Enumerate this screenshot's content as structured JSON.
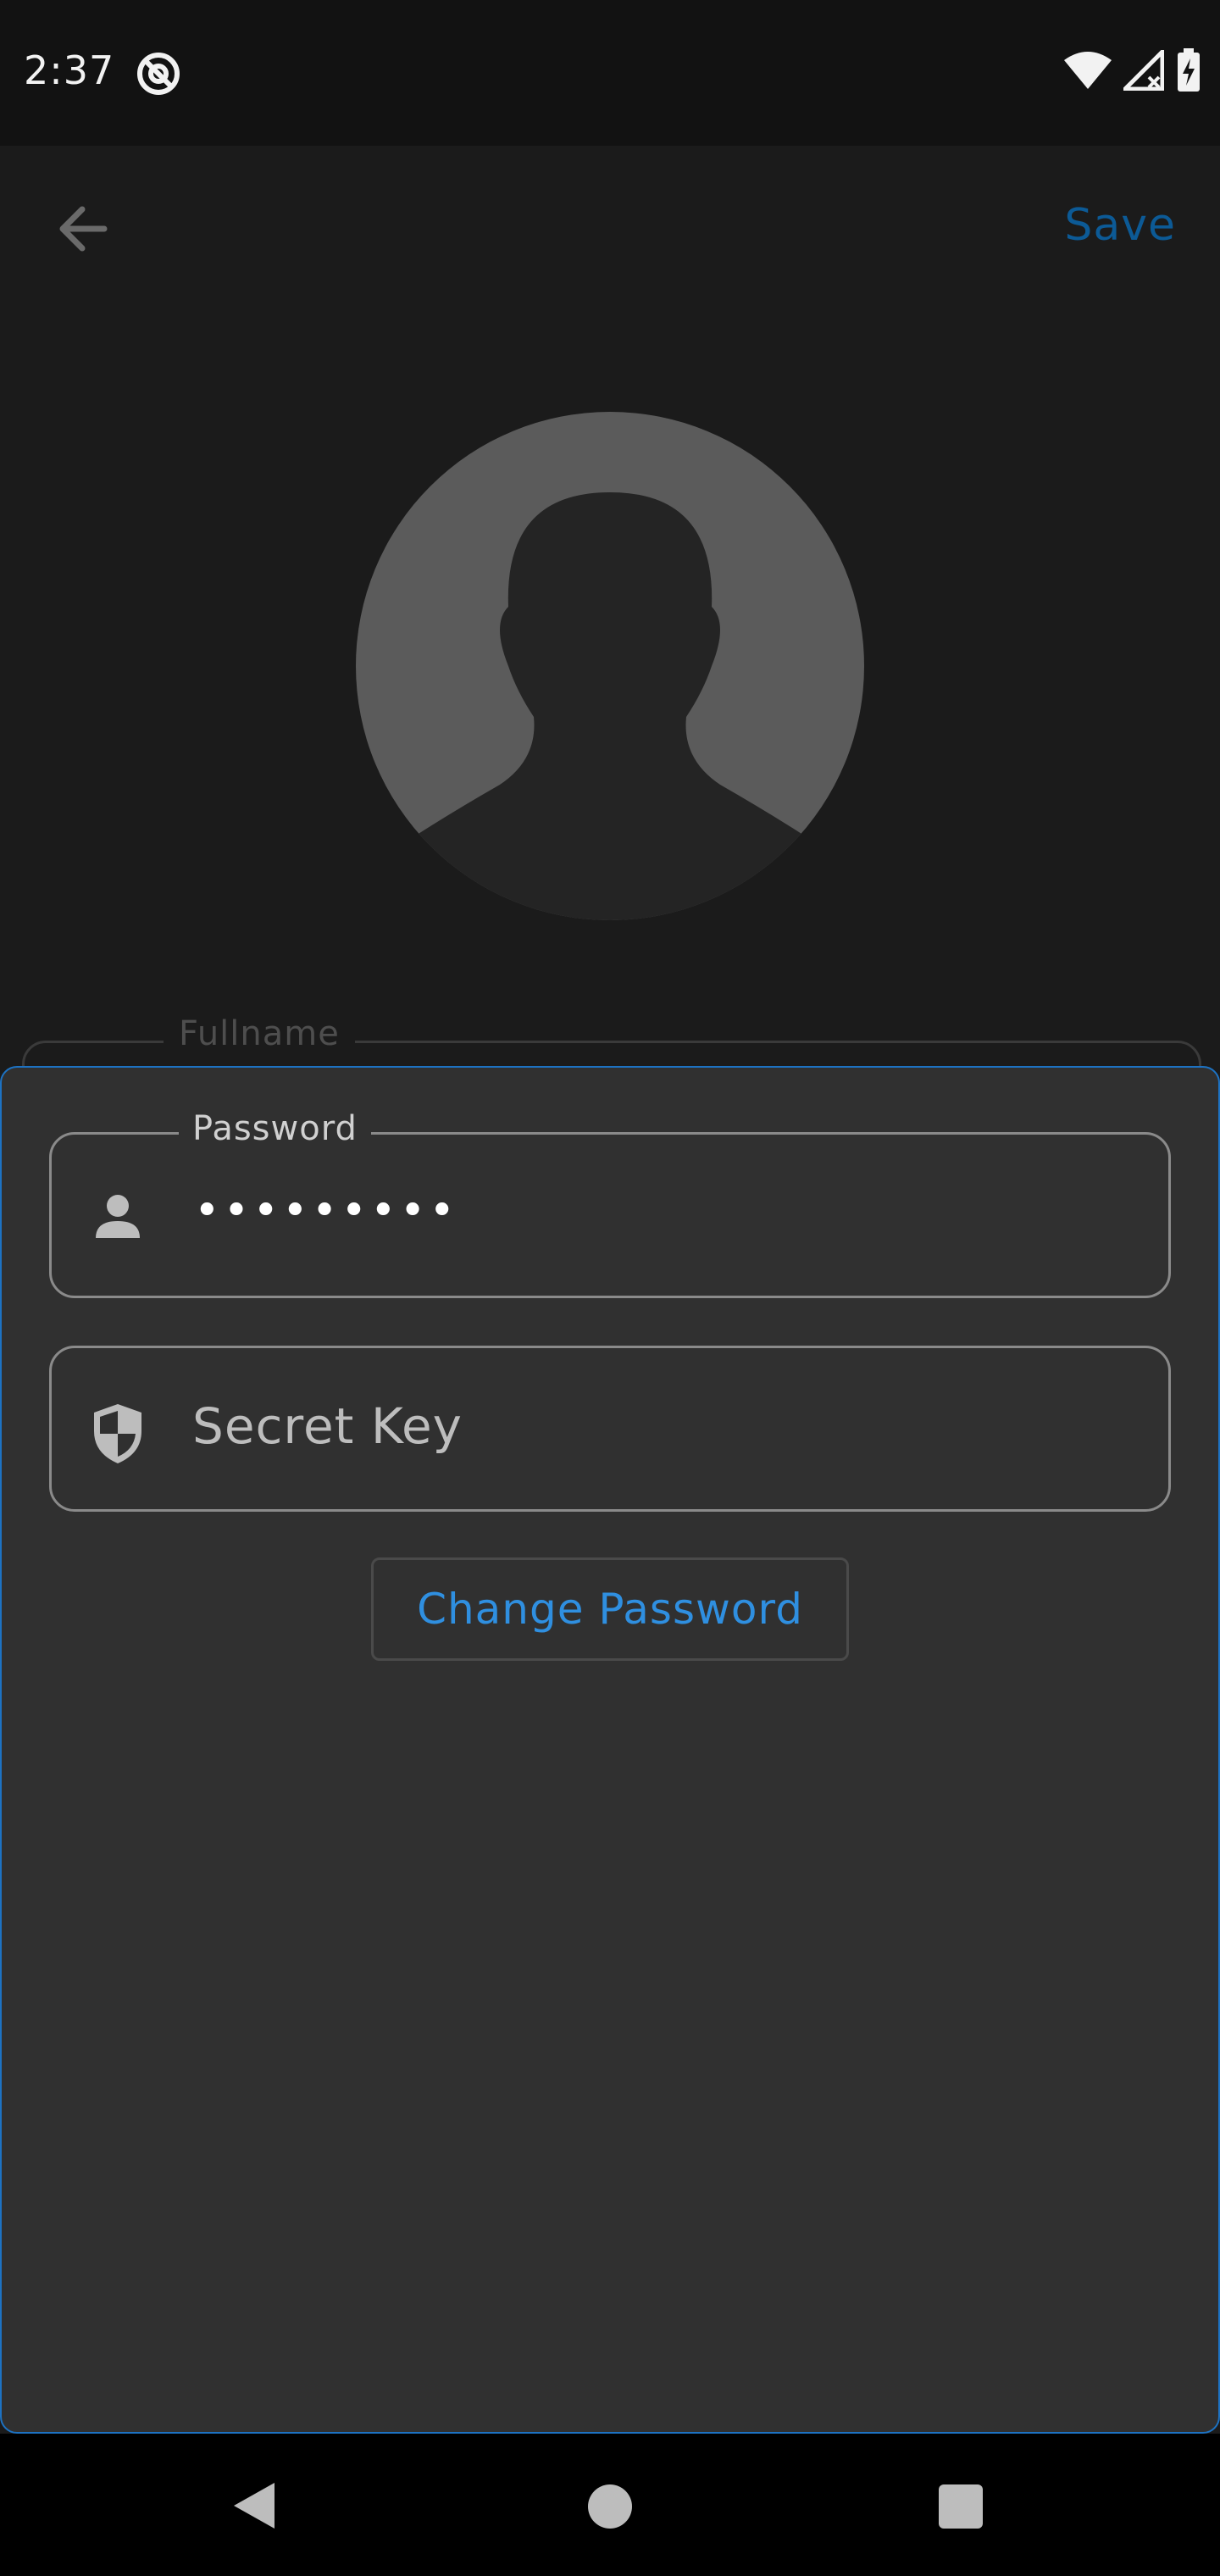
{
  "status_bar": {
    "time": "2:37",
    "app_icon": "at-sign-icon",
    "icons": [
      "wifi-icon",
      "signal-icon",
      "battery-charging-icon"
    ]
  },
  "app_bar": {
    "back_icon": "arrow-back-icon",
    "save_label": "Save"
  },
  "profile": {
    "avatar_icon": "person-silhouette-icon"
  },
  "background_form": {
    "fullname_label": "Fullname"
  },
  "sheet": {
    "password": {
      "label": "Password",
      "value": "•••••••••",
      "icon": "person-icon"
    },
    "secret_key": {
      "placeholder": "Secret Key",
      "icon": "shield-icon"
    },
    "change_password_label": "Change Password"
  },
  "colors": {
    "accent": "#2f8fe0",
    "sheet_border": "#1d72c2",
    "sheet_bg": "#303030",
    "page_bg": "#1b1b1b"
  }
}
